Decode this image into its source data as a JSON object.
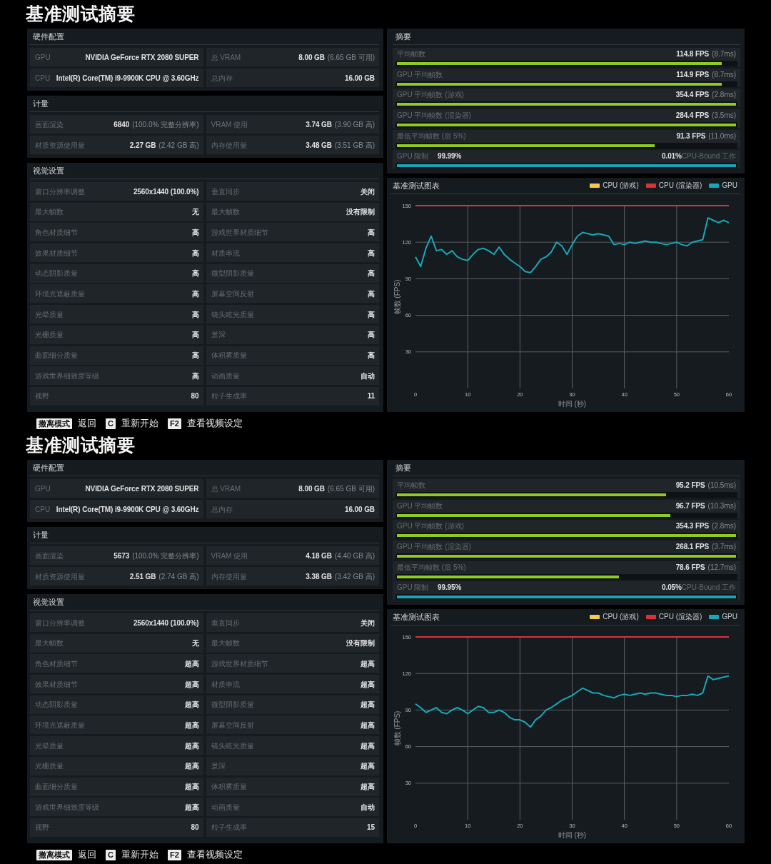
{
  "reports": [
    {
      "title": "基准测试摘要",
      "hardware": {
        "title": "硬件配置",
        "items": [
          {
            "label": "GPU",
            "value": "NVIDIA GeForce RTX 2080 SUPER"
          },
          {
            "label": "总 VRAM",
            "value": "8.00 GB",
            "note": "(6.65 GB 可用)"
          },
          {
            "label": "CPU",
            "value": "Intel(R) Core(TM) i9-9900K CPU @ 3.60GHz"
          },
          {
            "label": "总内存",
            "value": "16.00 GB"
          }
        ]
      },
      "metrics": {
        "title": "计量",
        "items": [
          {
            "label": "画面渲染",
            "value": "6840",
            "note": "(100.0% 完整分辨率)"
          },
          {
            "label": "VRAM 使用",
            "value": "3.74 GB",
            "note": "(3.90 GB 高)"
          },
          {
            "label": "材质资源使用量",
            "value": "2.27 GB",
            "note": "(2.42 GB 高)"
          },
          {
            "label": "内存使用量",
            "value": "3.48 GB",
            "note": "(3.51 GB 高)"
          }
        ]
      },
      "visual_settings": {
        "title": "视觉设置",
        "items": [
          {
            "label": "窗口分辨率调整",
            "value": "2560x1440 (100.0%)"
          },
          {
            "label": "垂直同步",
            "value": "关闭"
          },
          {
            "label": "最大帧数",
            "value": "无"
          },
          {
            "label": "最大帧数",
            "value": "没有限制"
          },
          {
            "label": "角色材质细节",
            "value": "高"
          },
          {
            "label": "游戏世界材质细节",
            "value": "高"
          },
          {
            "label": "效果材质细节",
            "value": "高"
          },
          {
            "label": "材质串流",
            "value": "高"
          },
          {
            "label": "动态阴影质量",
            "value": "高"
          },
          {
            "label": "微型阴影质量",
            "value": "高"
          },
          {
            "label": "环境光遮蔽质量",
            "value": "高"
          },
          {
            "label": "屏幕空间反射",
            "value": "高"
          },
          {
            "label": "光晕质量",
            "value": "高"
          },
          {
            "label": "镜头眩光质量",
            "value": "高"
          },
          {
            "label": "光栅质量",
            "value": "高"
          },
          {
            "label": "景深",
            "value": "高"
          },
          {
            "label": "曲面细分质量",
            "value": "高"
          },
          {
            "label": "体积雾质量",
            "value": "高"
          },
          {
            "label": "游戏世界细致度等级",
            "value": "高"
          },
          {
            "label": "动画质量",
            "value": "自动"
          },
          {
            "label": "视野",
            "value": "80"
          },
          {
            "label": "粒子生成率",
            "value": "11"
          }
        ]
      },
      "summary": {
        "title": "摘要",
        "rows": [
          {
            "kind": "fps",
            "label": "平均帧数",
            "value": "114.8 FPS",
            "note": "(8.7ms)",
            "level": 0.957
          },
          {
            "kind": "fps",
            "label": "GPU 平均帧数",
            "value": "114.9 FPS",
            "note": "(8.7ms)",
            "level": 0.958
          },
          {
            "kind": "fps",
            "label": "GPU 平均帧数 (游戏)",
            "value": "354.4 FPS",
            "note": "(2.8ms)",
            "level": 1
          },
          {
            "kind": "fps",
            "label": "GPU 平均帧数 (渲染器)",
            "value": "284.4 FPS",
            "note": "(3.5ms)",
            "level": 1
          },
          {
            "kind": "fps",
            "label": "最低平均帧数 (后 5%)",
            "value": "91.3 FPS",
            "note": "(11.0ms)",
            "level": 0.761
          },
          {
            "kind": "bound",
            "label": "GPU 限制",
            "value": "99.99%",
            "other_value": "0.01%",
            "other_label": "CPU-Bound 工作",
            "level": 0.9999
          }
        ]
      },
      "chart": {
        "chart_data": {
          "type": "line",
          "title": "基准测试图表",
          "xlabel": "时间 (秒)",
          "ylabel": "帧数 (FPS)",
          "grid": true,
          "x": [
            0,
            1,
            2,
            3,
            4,
            5,
            6,
            7,
            8,
            9,
            10,
            11,
            12,
            13,
            14,
            15,
            16,
            17,
            18,
            19,
            20,
            21,
            22,
            23,
            24,
            25,
            26,
            27,
            28,
            29,
            30,
            31,
            32,
            33,
            34,
            35,
            36,
            37,
            38,
            39,
            40,
            41,
            42,
            43,
            44,
            45,
            46,
            47,
            48,
            49,
            50,
            51,
            52,
            53,
            54,
            55,
            56,
            57,
            58,
            59,
            60
          ],
          "xlim": [
            0,
            60
          ],
          "ylim": [
            0,
            150
          ],
          "xticks": [
            0,
            10,
            20,
            30,
            40,
            50,
            60
          ],
          "yticks": [
            30,
            60,
            90,
            120,
            150
          ],
          "series": [
            {
              "name": "CPU (游戏)",
              "color": "#f2c94c",
              "values": [
                null,
                null,
                null,
                null,
                null,
                null,
                null,
                null,
                null,
                null,
                null,
                null,
                null,
                null,
                null,
                null,
                null,
                null,
                null,
                null,
                null,
                null,
                null,
                null,
                null,
                null,
                null,
                null,
                null,
                null,
                null,
                null,
                null,
                null,
                null,
                null,
                null,
                null,
                null,
                null,
                null,
                null,
                null,
                null,
                null,
                null,
                null,
                null,
                null,
                null,
                null,
                null,
                null,
                null,
                null,
                null,
                null,
                null,
                null,
                null,
                null
              ]
            },
            {
              "name": "CPU (渲染器)",
              "color": "#d8323c",
              "values": [
                150,
                150,
                150,
                150,
                150,
                150,
                150,
                150,
                150,
                150,
                150,
                150,
                150,
                150,
                150,
                150,
                150,
                150,
                150,
                150,
                150,
                150,
                150,
                150,
                150,
                150,
                150,
                150,
                150,
                150,
                150,
                150,
                150,
                150,
                150,
                150,
                150,
                150,
                150,
                150,
                150,
                150,
                150,
                150,
                150,
                150,
                150,
                150,
                150,
                150,
                150,
                150,
                150,
                150,
                150,
                150,
                150,
                150,
                150,
                150,
                150
              ]
            },
            {
              "name": "GPU",
              "color": "#17a8b8",
              "values": [
                108,
                100,
                115,
                125,
                113,
                114,
                110,
                113,
                108,
                106,
                105,
                110,
                114,
                115,
                113,
                110,
                116,
                110,
                106,
                103,
                100,
                96,
                95,
                100,
                106,
                108,
                112,
                120,
                117,
                110,
                118,
                125,
                128,
                127,
                126,
                127,
                126,
                125,
                118,
                119,
                118,
                120,
                119,
                120,
                121,
                120,
                120,
                119,
                118,
                119,
                120,
                118,
                117,
                120,
                121,
                122,
                140,
                138,
                136,
                138,
                136
              ]
            }
          ]
        }
      },
      "footer": [
        {
          "key": "撤离模式",
          "action": "返回"
        },
        {
          "key": "C",
          "action": "重新开始"
        },
        {
          "key": "F2",
          "action": "查看视频设定"
        }
      ]
    },
    {
      "title": "基准测试摘要",
      "hardware": {
        "title": "硬件配置",
        "items": [
          {
            "label": "GPU",
            "value": "NVIDIA GeForce RTX 2080 SUPER"
          },
          {
            "label": "总 VRAM",
            "value": "8.00 GB",
            "note": "(6.65 GB 可用)"
          },
          {
            "label": "CPU",
            "value": "Intel(R) Core(TM) i9-9900K CPU @ 3.60GHz"
          },
          {
            "label": "总内存",
            "value": "16.00 GB"
          }
        ]
      },
      "metrics": {
        "title": "计量",
        "items": [
          {
            "label": "画面渲染",
            "value": "5673",
            "note": "(100.0% 完整分辨率)"
          },
          {
            "label": "VRAM 使用",
            "value": "4.18 GB",
            "note": "(4.40 GB 高)"
          },
          {
            "label": "材质资源使用量",
            "value": "2.51 GB",
            "note": "(2.74 GB 高)"
          },
          {
            "label": "内存使用量",
            "value": "3.38 GB",
            "note": "(3.42 GB 高)"
          }
        ]
      },
      "visual_settings": {
        "title": "视觉设置",
        "items": [
          {
            "label": "窗口分辨率调整",
            "value": "2560x1440 (100.0%)"
          },
          {
            "label": "垂直同步",
            "value": "关闭"
          },
          {
            "label": "最大帧数",
            "value": "无"
          },
          {
            "label": "最大帧数",
            "value": "没有限制"
          },
          {
            "label": "角色材质细节",
            "value": "超高"
          },
          {
            "label": "游戏世界材质细节",
            "value": "超高"
          },
          {
            "label": "效果材质细节",
            "value": "超高"
          },
          {
            "label": "材质串流",
            "value": "超高"
          },
          {
            "label": "动态阴影质量",
            "value": "超高"
          },
          {
            "label": "微型阴影质量",
            "value": "超高"
          },
          {
            "label": "环境光遮蔽质量",
            "value": "超高"
          },
          {
            "label": "屏幕空间反射",
            "value": "超高"
          },
          {
            "label": "光晕质量",
            "value": "超高"
          },
          {
            "label": "镜头眩光质量",
            "value": "超高"
          },
          {
            "label": "光栅质量",
            "value": "超高"
          },
          {
            "label": "景深",
            "value": "超高"
          },
          {
            "label": "曲面细分质量",
            "value": "超高"
          },
          {
            "label": "体积雾质量",
            "value": "超高"
          },
          {
            "label": "游戏世界细致度等级",
            "value": "超高"
          },
          {
            "label": "动画质量",
            "value": "自动"
          },
          {
            "label": "视野",
            "value": "80"
          },
          {
            "label": "粒子生成率",
            "value": "15"
          }
        ]
      },
      "summary": {
        "title": "摘要",
        "rows": [
          {
            "kind": "fps",
            "label": "平均帧数",
            "value": "95.2 FPS",
            "note": "(10.5ms)",
            "level": 0.793
          },
          {
            "kind": "fps",
            "label": "GPU 平均帧数",
            "value": "96.7 FPS",
            "note": "(10.3ms)",
            "level": 0.806
          },
          {
            "kind": "fps",
            "label": "GPU 平均帧数 (游戏)",
            "value": "354.3 FPS",
            "note": "(2.8ms)",
            "level": 1
          },
          {
            "kind": "fps",
            "label": "GPU 平均帧数 (渲染器)",
            "value": "268.1 FPS",
            "note": "(3.7ms)",
            "level": 1
          },
          {
            "kind": "fps",
            "label": "最低平均帧数 (后 5%)",
            "value": "78.6 FPS",
            "note": "(12.7ms)",
            "level": 0.655
          },
          {
            "kind": "bound",
            "label": "GPU 限制",
            "value": "99.95%",
            "other_value": "0.05%",
            "other_label": "CPU-Bound 工作",
            "level": 0.9995
          }
        ]
      },
      "chart": {
        "chart_data": {
          "type": "line",
          "title": "基准测试图表",
          "xlabel": "时间 (秒)",
          "ylabel": "帧数 (FPS)",
          "grid": true,
          "x": [
            0,
            1,
            2,
            3,
            4,
            5,
            6,
            7,
            8,
            9,
            10,
            11,
            12,
            13,
            14,
            15,
            16,
            17,
            18,
            19,
            20,
            21,
            22,
            23,
            24,
            25,
            26,
            27,
            28,
            29,
            30,
            31,
            32,
            33,
            34,
            35,
            36,
            37,
            38,
            39,
            40,
            41,
            42,
            43,
            44,
            45,
            46,
            47,
            48,
            49,
            50,
            51,
            52,
            53,
            54,
            55,
            56,
            57,
            58,
            59,
            60
          ],
          "xlim": [
            0,
            60
          ],
          "ylim": [
            0,
            150
          ],
          "xticks": [
            0,
            10,
            20,
            30,
            40,
            50,
            60
          ],
          "yticks": [
            30,
            60,
            90,
            120,
            150
          ],
          "series": [
            {
              "name": "CPU (游戏)",
              "color": "#f2c94c",
              "values": [
                null,
                null,
                null,
                null,
                null,
                null,
                null,
                null,
                null,
                null,
                null,
                null,
                null,
                null,
                null,
                null,
                null,
                null,
                null,
                null,
                null,
                null,
                null,
                null,
                null,
                null,
                null,
                null,
                null,
                null,
                null,
                null,
                null,
                null,
                null,
                null,
                null,
                null,
                null,
                null,
                null,
                null,
                null,
                null,
                null,
                null,
                null,
                null,
                null,
                null,
                null,
                null,
                null,
                null,
                null,
                null,
                null,
                null,
                null,
                null,
                null
              ]
            },
            {
              "name": "CPU (渲染器)",
              "color": "#d8323c",
              "values": [
                150,
                150,
                150,
                150,
                150,
                150,
                150,
                150,
                150,
                150,
                150,
                150,
                150,
                150,
                150,
                150,
                150,
                150,
                150,
                150,
                150,
                150,
                150,
                150,
                150,
                150,
                150,
                150,
                150,
                150,
                150,
                150,
                150,
                150,
                150,
                150,
                150,
                150,
                150,
                150,
                150,
                150,
                150,
                150,
                150,
                150,
                150,
                150,
                150,
                150,
                150,
                150,
                150,
                150,
                150,
                150,
                150,
                150,
                150,
                150,
                150
              ]
            },
            {
              "name": "GPU",
              "color": "#17a8b8",
              "values": [
                95,
                92,
                88,
                90,
                92,
                88,
                87,
                90,
                92,
                90,
                87,
                90,
                93,
                92,
                88,
                88,
                90,
                88,
                84,
                82,
                82,
                80,
                76,
                82,
                85,
                90,
                92,
                95,
                98,
                100,
                102,
                105,
                108,
                106,
                104,
                104,
                102,
                101,
                100,
                102,
                103,
                102,
                103,
                104,
                103,
                104,
                104,
                103,
                102,
                102,
                101,
                102,
                102,
                103,
                102,
                104,
                118,
                115,
                116,
                117,
                118
              ]
            }
          ]
        }
      },
      "footer": [
        {
          "key": "撤离模式",
          "action": "返回"
        },
        {
          "key": "C",
          "action": "重新开始"
        },
        {
          "key": "F2",
          "action": "查看视频设定"
        }
      ]
    }
  ]
}
